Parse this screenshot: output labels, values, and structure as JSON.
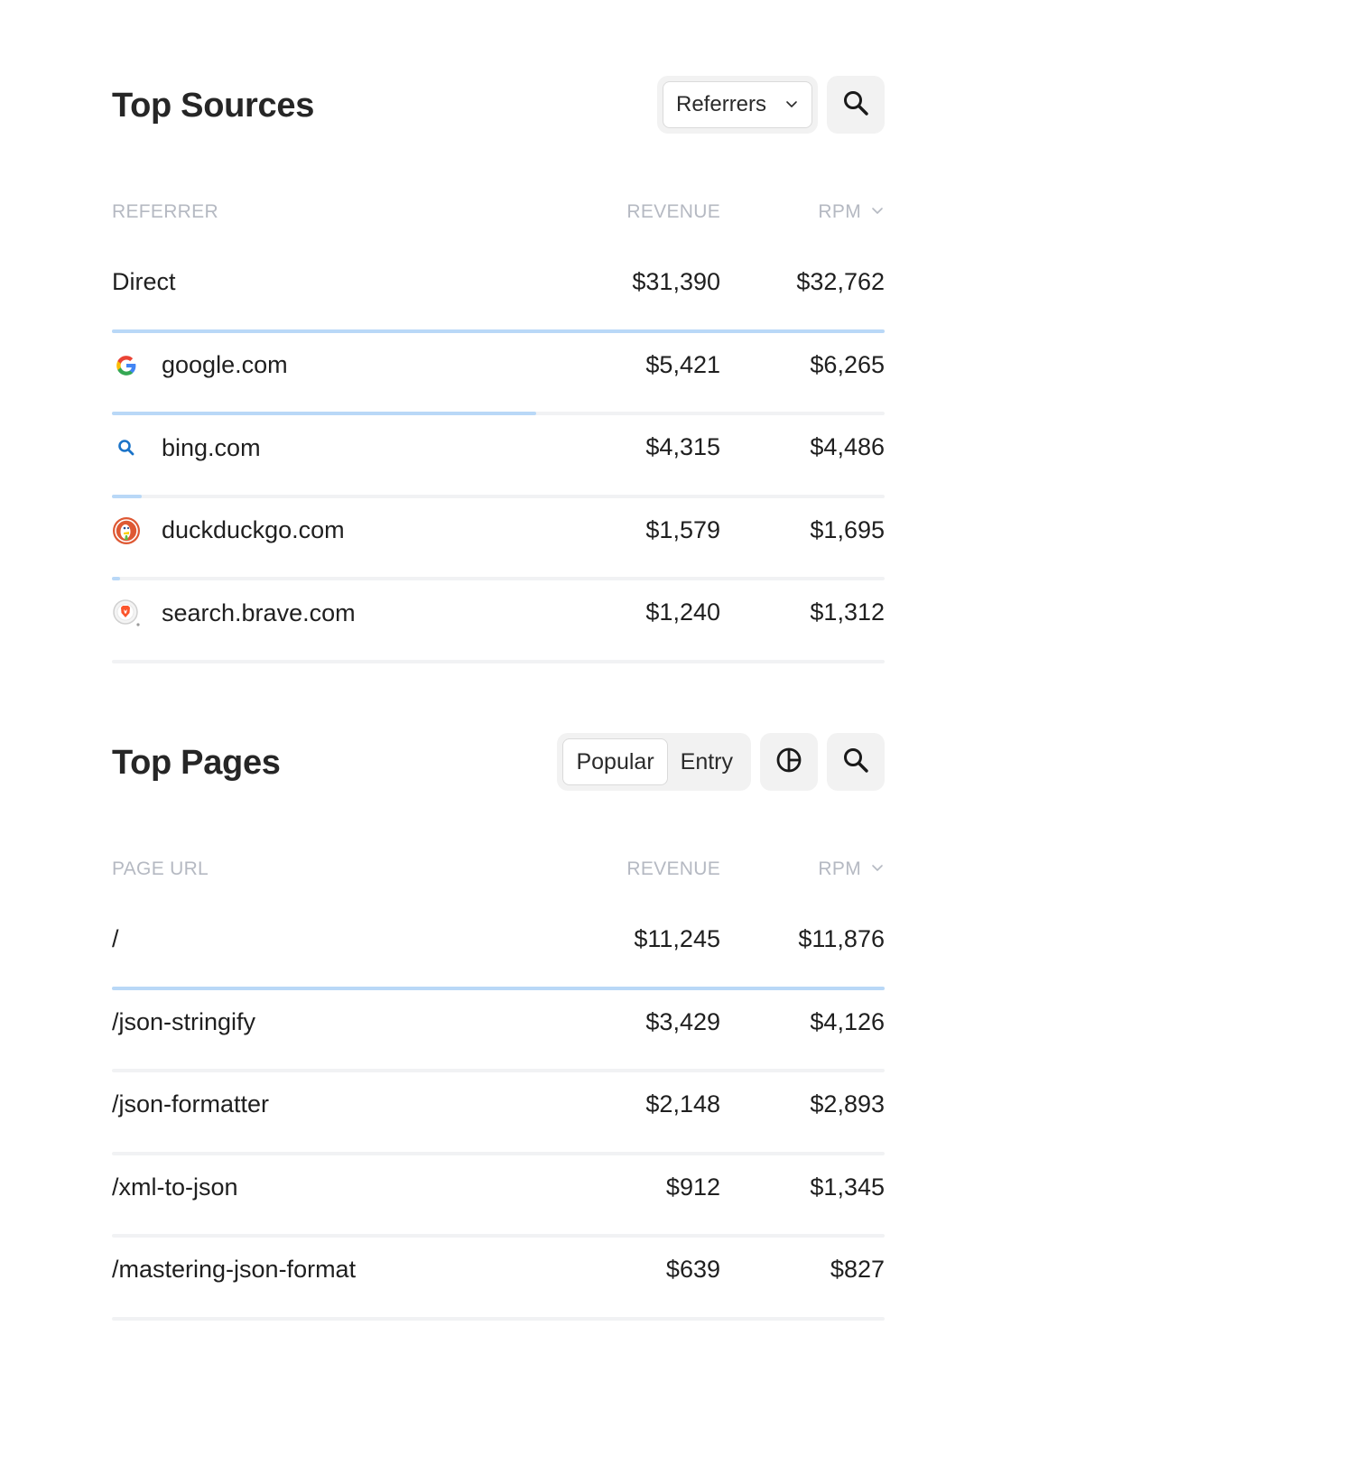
{
  "sources": {
    "title": "Top Sources",
    "dropdown_label": "Referrers",
    "columns": {
      "name": "REFERRER",
      "revenue": "REVENUE",
      "rpm": "RPM"
    },
    "rows": [
      {
        "name": "Direct",
        "icon": "",
        "revenue": "$31,390",
        "rpm": "$32,762",
        "share": 1.0
      },
      {
        "name": "google.com",
        "icon": "google-icon",
        "revenue": "$5,421",
        "rpm": "$6,265",
        "share": 0.549
      },
      {
        "name": "bing.com",
        "icon": "bing-icon",
        "revenue": "$4,315",
        "rpm": "$4,486",
        "share": 0.039
      },
      {
        "name": "duckduckgo.com",
        "icon": "duckduckgo-icon",
        "revenue": "$1,579",
        "rpm": "$1,695",
        "share": 0.01
      },
      {
        "name": "search.brave.com",
        "icon": "brave-icon",
        "revenue": "$1,240",
        "rpm": "$1,312",
        "share": 0.0
      }
    ]
  },
  "pages": {
    "title": "Top Pages",
    "tabs": [
      {
        "label": "Popular",
        "active": true
      },
      {
        "label": "Entry",
        "active": false
      }
    ],
    "columns": {
      "name": "PAGE URL",
      "revenue": "REVENUE",
      "rpm": "RPM"
    },
    "rows": [
      {
        "name": "/",
        "revenue": "$11,245",
        "rpm": "$11,876",
        "share": 1.0
      },
      {
        "name": "/json-stringify",
        "revenue": "$3,429",
        "rpm": "$4,126",
        "share": 0.0
      },
      {
        "name": "/json-formatter",
        "revenue": "$2,148",
        "rpm": "$2,893",
        "share": 0.0
      },
      {
        "name": "/xml-to-json",
        "revenue": "$912",
        "rpm": "$1,345",
        "share": 0.0
      },
      {
        "name": "/mastering-json-format",
        "revenue": "$639",
        "rpm": "$827",
        "share": 0.0
      }
    ]
  },
  "colors": {
    "bar_fill": "#b9d8f7",
    "bar_track": "#f1f2f4",
    "header_muted": "#b5b9c2"
  }
}
